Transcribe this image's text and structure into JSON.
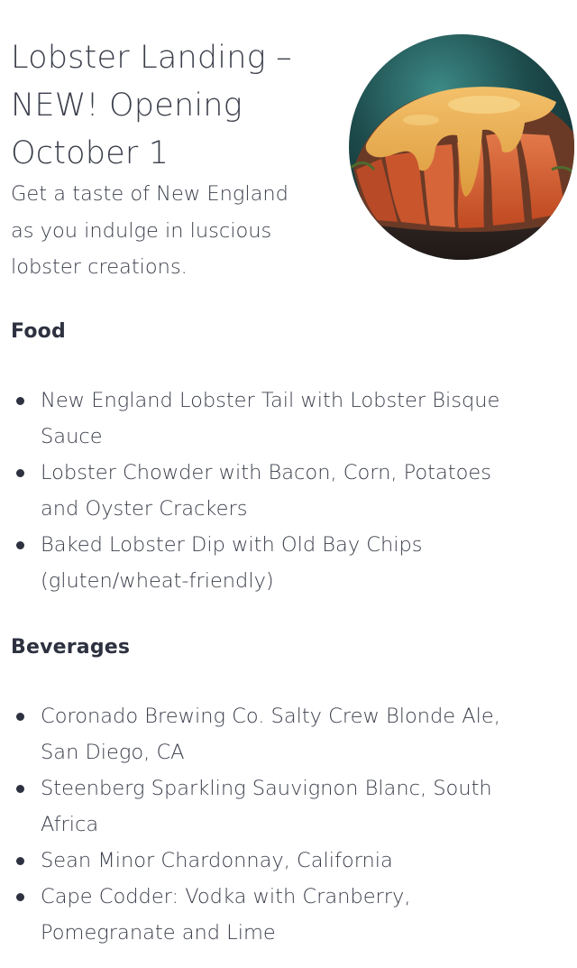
{
  "hero": {
    "title_lines": [
      "Lobster Landing –",
      "NEW! Opening",
      "October 1"
    ],
    "description_lines": [
      "Get a taste of New England",
      "as you indulge in luscious",
      "lobster creations."
    ],
    "image_subject": "lobster-tail-with-bisque-sauce"
  },
  "food": {
    "heading": "Food",
    "items": [
      {
        "lines": [
          "New England Lobster Tail with Lobster Bisque",
          "Sauce"
        ]
      },
      {
        "lines": [
          "Lobster Chowder with Bacon, Corn, Potatoes",
          "and Oyster Crackers"
        ]
      },
      {
        "lines": [
          "Baked Lobster Dip with Old Bay Chips",
          "(gluten/wheat-friendly)"
        ]
      }
    ]
  },
  "beverages": {
    "heading": "Beverages",
    "items": [
      {
        "lines": [
          "Coronado Brewing Co. Salty Crew Blonde Ale,",
          "San Diego, CA"
        ]
      },
      {
        "lines": [
          "Steenberg Sparkling Sauvignon Blanc, South",
          "Africa"
        ]
      },
      {
        "lines": [
          "Sean Minor Chardonnay, California"
        ]
      },
      {
        "lines": [
          "Cape Codder: Vodka with Cranberry,",
          "Pomegranate and Lime"
        ]
      }
    ]
  },
  "colors": {
    "text": "#3b3f4b",
    "heading": "#2d3140",
    "background": "#ffffff"
  }
}
